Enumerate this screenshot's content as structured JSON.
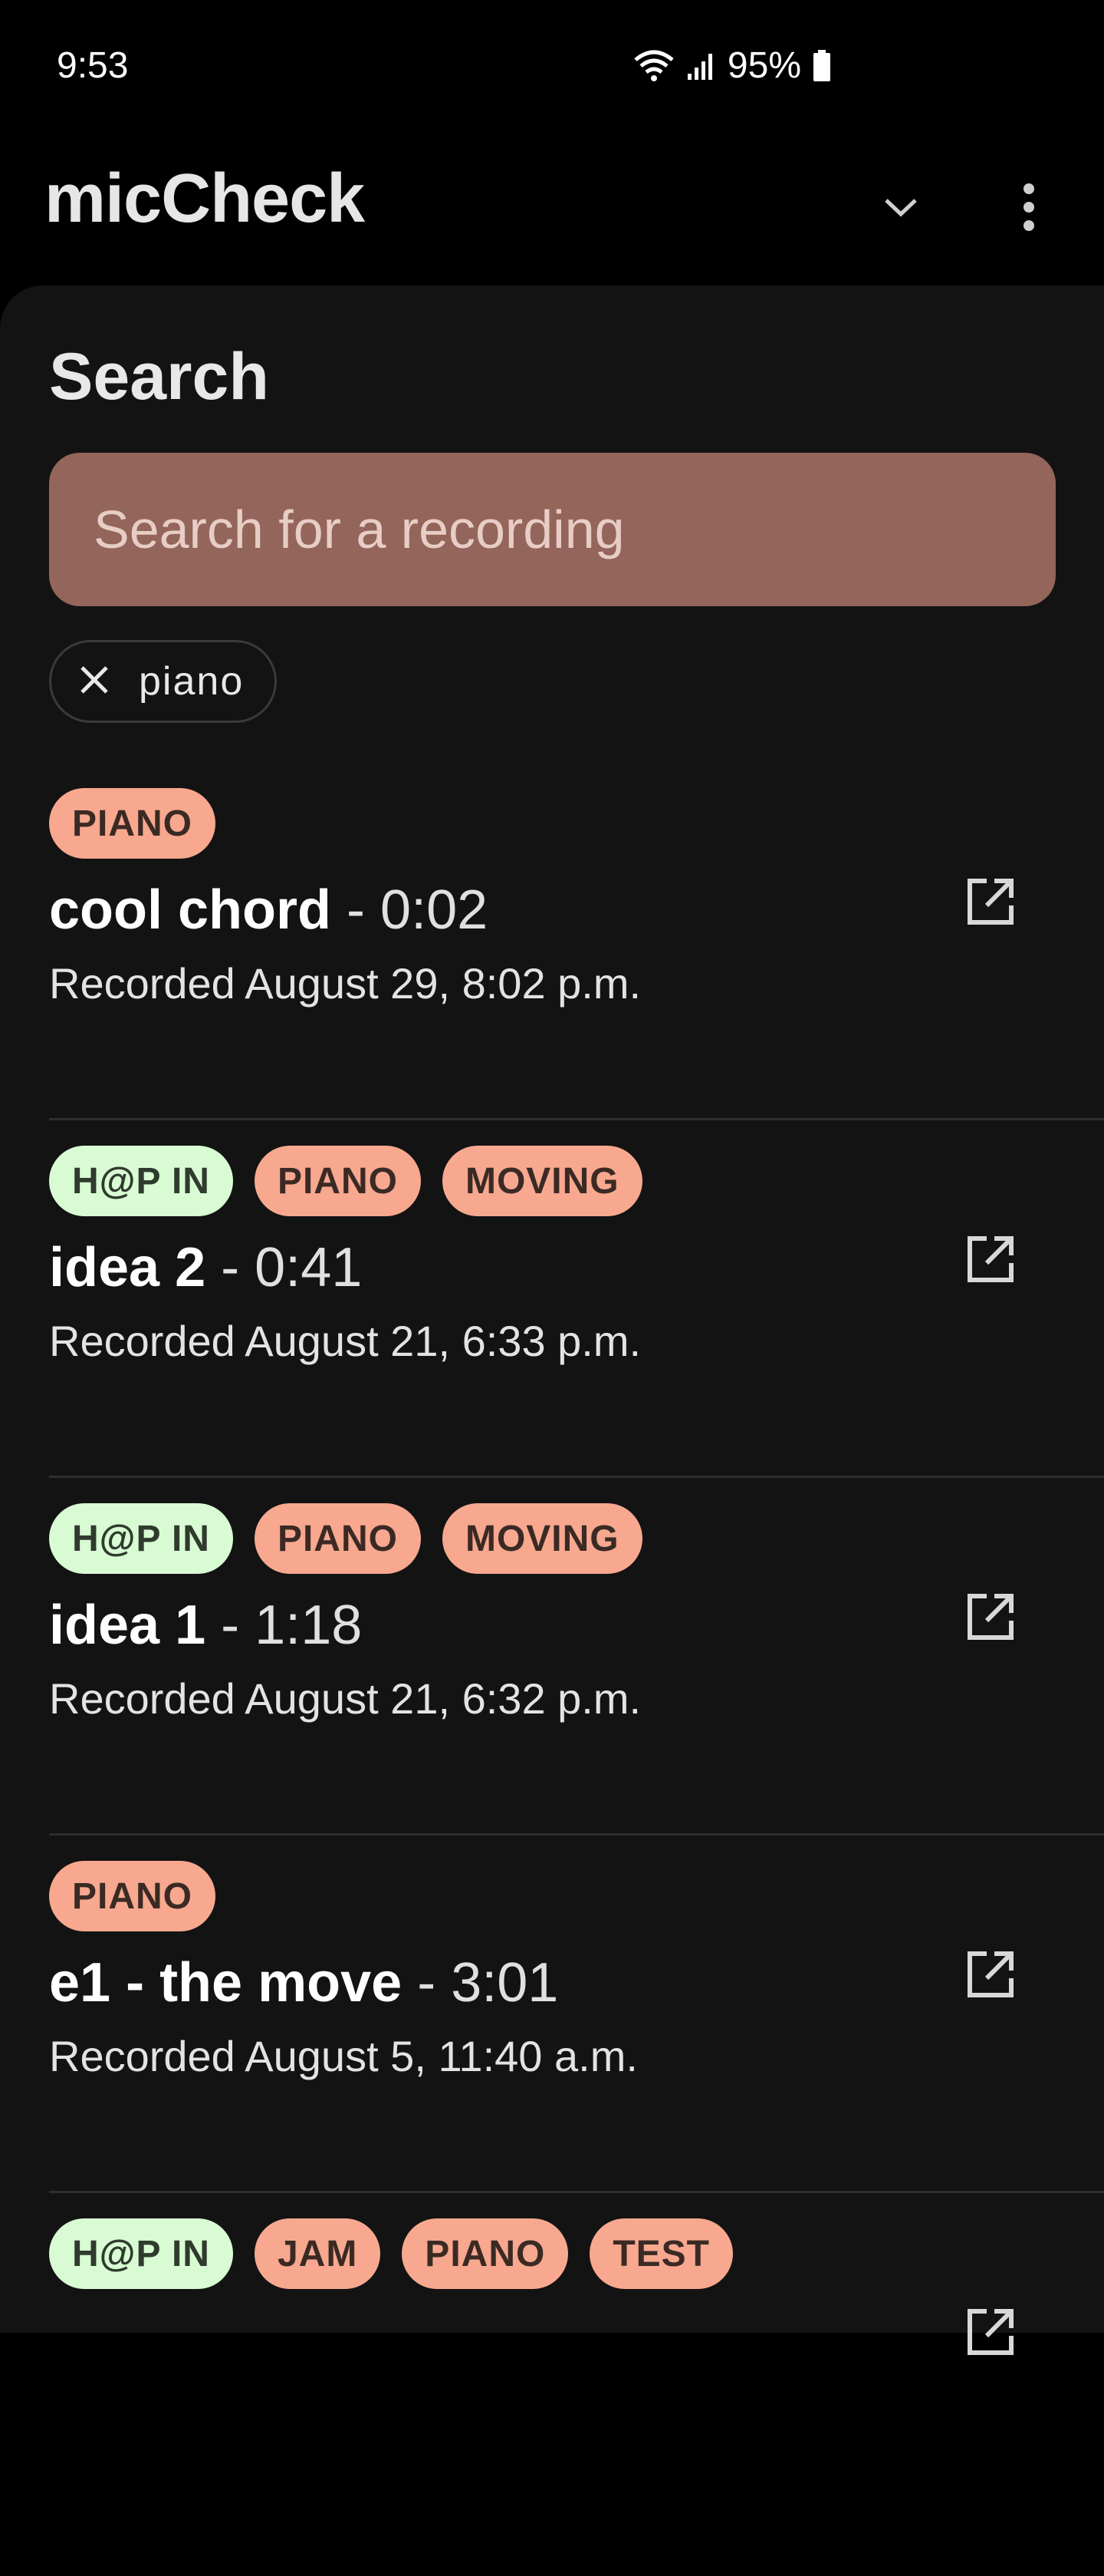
{
  "status_bar": {
    "time": "9:53",
    "battery": "95%"
  },
  "app_bar": {
    "title": "micCheck"
  },
  "search": {
    "heading": "Search",
    "placeholder": "Search for a recording",
    "active_filter": "piano"
  },
  "recordings": [
    {
      "tags": [
        {
          "label": "PIANO",
          "kind": "piano"
        }
      ],
      "name": "cool chord",
      "separator": "-",
      "duration": "0:02",
      "recorded": "Recorded August 29, 8:02 p.m."
    },
    {
      "tags": [
        {
          "label": "H@P IN",
          "kind": "hap"
        },
        {
          "label": "PIANO",
          "kind": "piano"
        },
        {
          "label": "MOVING",
          "kind": "moving"
        }
      ],
      "name": "idea 2",
      "separator": "-",
      "duration": "0:41",
      "recorded": "Recorded August 21, 6:33 p.m."
    },
    {
      "tags": [
        {
          "label": "H@P IN",
          "kind": "hap"
        },
        {
          "label": "PIANO",
          "kind": "piano"
        },
        {
          "label": "MOVING",
          "kind": "moving"
        }
      ],
      "name": "idea 1",
      "separator": "-",
      "duration": "1:18",
      "recorded": "Recorded August 21, 6:32 p.m."
    },
    {
      "tags": [
        {
          "label": "PIANO",
          "kind": "piano"
        }
      ],
      "name": "e1 - the move",
      "separator": "-",
      "duration": "3:01",
      "recorded": "Recorded August 5, 11:40 a.m."
    },
    {
      "tags": [
        {
          "label": "H@P IN",
          "kind": "hap"
        },
        {
          "label": "JAM",
          "kind": "jam"
        },
        {
          "label": "PIANO",
          "kind": "piano"
        },
        {
          "label": "TEST",
          "kind": "test"
        }
      ],
      "name": "",
      "separator": "",
      "duration": "",
      "recorded": ""
    }
  ],
  "colors": {
    "background": "#000000",
    "sheet": "#131313",
    "search_box": "#94655a",
    "tag_default": "#f7a88f",
    "tag_hap": "#d8fbd4"
  },
  "icons": [
    "wifi-icon",
    "signal-icon",
    "battery-icon",
    "chevron-down-icon",
    "more-vert-icon",
    "close-icon",
    "open-in-new-icon"
  ]
}
